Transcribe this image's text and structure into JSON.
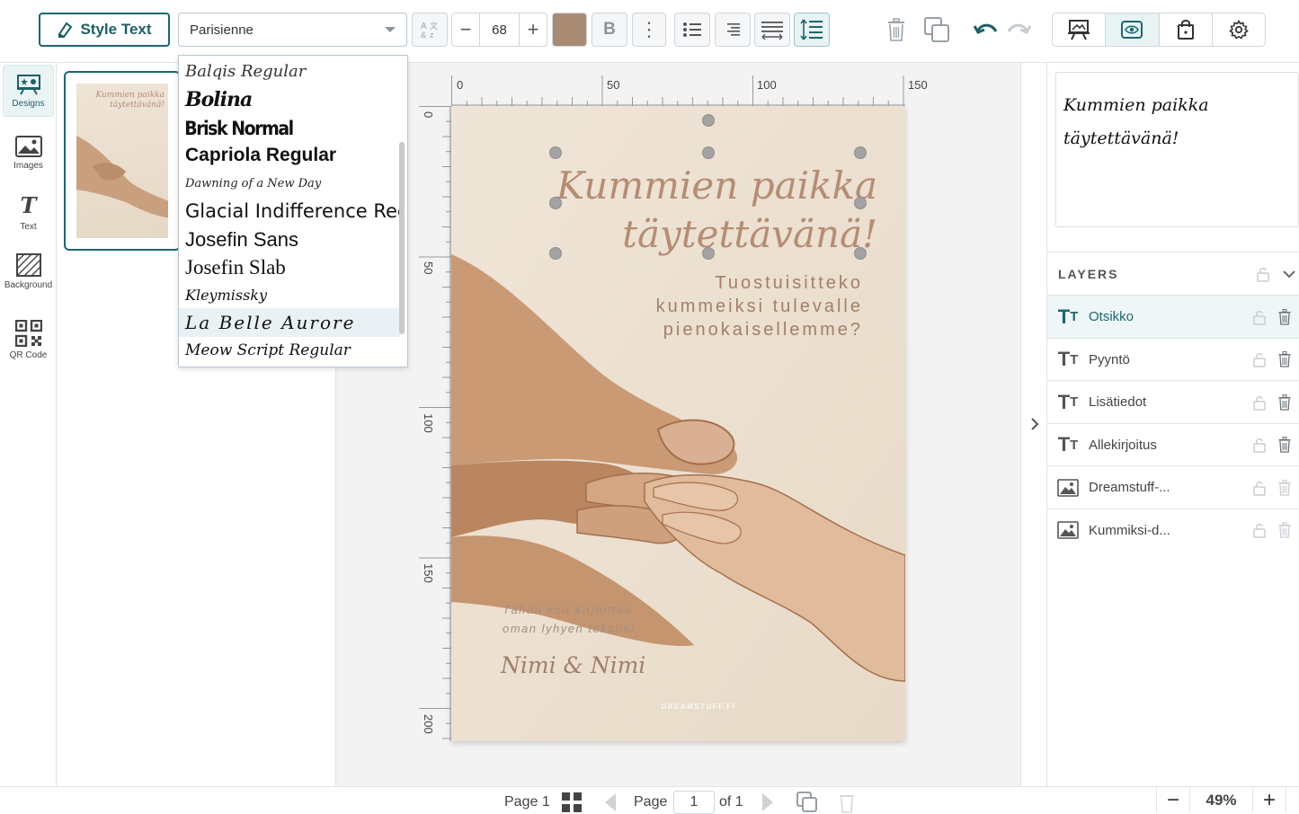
{
  "toolbar": {
    "style_text_label": "Style Text",
    "font_selected": "Parisienne",
    "font_size": "68",
    "size_minus": "−",
    "size_plus": "+",
    "text_color": "#a98a73",
    "bold_label": "B",
    "more_label": "⋮"
  },
  "font_list": [
    "Balqis Regular",
    "Bolina",
    "Brisk Normal",
    "Capriola Regular",
    "Dawning of a New Day",
    "Glacial Indifference Regular",
    "Josefin Sans",
    "Josefin Slab",
    "Kleymissky",
    "La Belle Aurore",
    "Meow Script Regular"
  ],
  "font_list_highlighted": "La Belle Aurore",
  "rail": {
    "designs": "Designs",
    "images": "Images",
    "text": "Text",
    "background": "Background",
    "qr": "QR Code"
  },
  "ruler": {
    "top": [
      "0",
      "50",
      "100",
      "150"
    ],
    "left": [
      "0",
      "50",
      "100",
      "150",
      "200"
    ]
  },
  "card": {
    "title_line1": "Kummien paikka",
    "title_line2": "täytettävänä!",
    "sub_line1": "Tuostuisitteko",
    "sub_line2": "kummeiksi tulevalle",
    "sub_line3": "pienokaisellemme?",
    "extra_line1": "Tähän voit kirjoittaa",
    "extra_line2": "oman lyhyen tekstisi.",
    "sign": "Nimi & Nimi",
    "brand": "DREAMSTUFF.FI"
  },
  "preview": {
    "line1": "Kummien paikka",
    "line2": "täytettävänä!"
  },
  "layers": {
    "heading": "LAYERS",
    "items": [
      {
        "name": "Otsikko",
        "type": "text"
      },
      {
        "name": "Pyyntö",
        "type": "text"
      },
      {
        "name": "Lisätiedot",
        "type": "text"
      },
      {
        "name": "Allekirjoitus",
        "type": "text"
      },
      {
        "name": "Dreamstuff-...",
        "type": "image"
      },
      {
        "name": "Kummiksi-d...",
        "type": "image"
      }
    ]
  },
  "bottom": {
    "page_label": "Page 1",
    "page_word": "Page",
    "page_num": "1",
    "of_label": "of 1",
    "zoom": "49%",
    "zoom_minus": "−",
    "zoom_plus": "+"
  }
}
